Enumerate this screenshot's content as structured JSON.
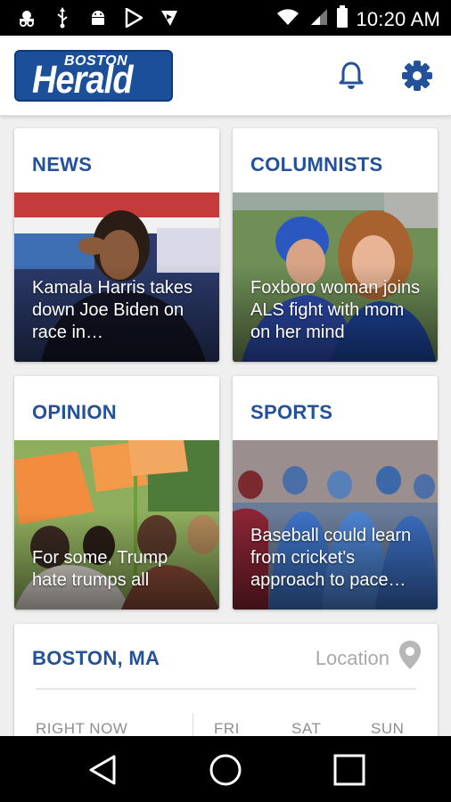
{
  "status_bar": {
    "time": "10:20 AM",
    "left_icons": [
      "incognito-icon",
      "usb-icon",
      "android-icon",
      "play-store-icon",
      "play-movies-icon"
    ],
    "right_icons": [
      "wifi-icon",
      "cell-signal-icon",
      "battery-icon"
    ]
  },
  "app_bar": {
    "logo_small": "BOSTON",
    "logo_big": "Herald",
    "bell_icon": "bell-icon",
    "settings_icon": "gear-icon",
    "accent_color": "#24529a"
  },
  "sections": [
    {
      "title": "NEWS",
      "headline": "Kamala Harris takes down Joe Biden on race in…"
    },
    {
      "title": "COLUMNISTS",
      "headline": "Foxboro woman joins ALS fight with mom on her mind"
    },
    {
      "title": "OPINION",
      "headline": "For some, Trump hate trumps all"
    },
    {
      "title": "SPORTS",
      "headline": "Baseball could learn from cricket's approach to pace…"
    }
  ],
  "weather": {
    "city": "BOSTON, MA",
    "location_label": "Location",
    "right_now": "RIGHT NOW",
    "days": [
      "FRI",
      "SAT",
      "SUN"
    ]
  },
  "nav_bar": {
    "back_icon": "back-triangle-icon",
    "home_icon": "home-circle-icon",
    "recents_icon": "recents-square-icon"
  }
}
